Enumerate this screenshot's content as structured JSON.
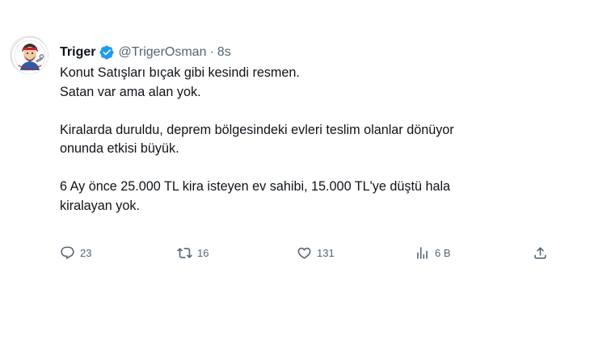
{
  "tweet": {
    "author": {
      "name": "Triger",
      "handle": "@TrigerOsman",
      "separator": "·",
      "time": "8s",
      "verified": true,
      "avatar_icon": "cartoon-avatar-icon"
    },
    "lines": [
      "Konut Satışları bıçak gibi kesindi resmen.",
      "Satan var ama alan yok.",
      "",
      "Kiralarda duruldu, deprem bölgesindeki evleri teslim olanlar dönüyor",
      "onunda etkisi büyük.",
      "",
      "6 Ay önce 25.000 TL kira isteyen ev sahibi, 15.000 TL'ye düştü hala",
      "kiralayan yok."
    ],
    "actions": {
      "reply": {
        "icon": "reply-icon",
        "count": "23"
      },
      "retweet": {
        "icon": "retweet-icon",
        "count": "16"
      },
      "like": {
        "icon": "heart-icon",
        "count": "131"
      },
      "views": {
        "icon": "views-chart-icon",
        "count": "6 B"
      },
      "share": {
        "icon": "share-icon"
      }
    }
  },
  "colors": {
    "text": "#0f1419",
    "muted": "#536471",
    "verified_blue": "#1d9bf0",
    "background": "#ffffff"
  }
}
